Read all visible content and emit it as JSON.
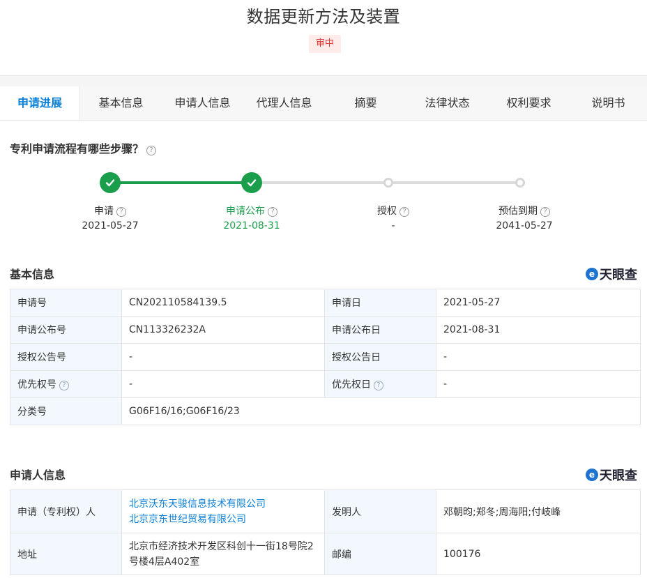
{
  "page": {
    "title": "数据更新方法及装置",
    "status_badge": "审中"
  },
  "tabs": [
    {
      "label": "申请进展",
      "active": true
    },
    {
      "label": "基本信息"
    },
    {
      "label": "申请人信息"
    },
    {
      "label": "代理人信息"
    },
    {
      "label": "摘要"
    },
    {
      "label": "法律状态"
    },
    {
      "label": "权利要求"
    },
    {
      "label": "说明书"
    }
  ],
  "process": {
    "title": "专利申请流程有哪些步骤？",
    "steps": [
      {
        "label": "申请",
        "date": "2021-05-27",
        "done": true
      },
      {
        "label": "申请公布",
        "date": "2021-08-31",
        "done": true
      },
      {
        "label": "授权",
        "date": "-",
        "done": false
      },
      {
        "label": "预估到期",
        "date": "2041-05-27",
        "done": false
      }
    ]
  },
  "brand": {
    "name": "天眼查"
  },
  "basic_info": {
    "title": "基本信息",
    "rows": [
      {
        "l1": "申请号",
        "v1": "CN202110584139.5",
        "l2": "申请日",
        "v2": "2021-05-27"
      },
      {
        "l1": "申请公布号",
        "v1": "CN113326232A",
        "l2": "申请公布日",
        "v2": "2021-08-31"
      },
      {
        "l1": "授权公告号",
        "v1": "-",
        "l2": "授权公告日",
        "v2": "-"
      },
      {
        "l1": "优先权号",
        "v1": "-",
        "l2": "优先权日",
        "v2": "-"
      },
      {
        "l1": "分类号",
        "v1": "G06F16/16;G06F16/23"
      }
    ]
  },
  "applicant_info": {
    "title": "申请人信息",
    "applicant_label": "申请（专利权）人",
    "applicants": [
      "北京沃东天骏信息技术有限公司",
      "北京京东世纪贸易有限公司"
    ],
    "inventor_label": "发明人",
    "inventors": "邓朝昀;郑冬;周海阳;付岐峰",
    "address_label": "地址",
    "address": "北京市经济技术开发区科创十一街18号院2号楼4层A402室",
    "postcode_label": "邮编",
    "postcode": "100176"
  },
  "colors": {
    "accent": "#0b7fd6",
    "done": "#1b9e4b",
    "badge_bg": "#fdecea",
    "badge_text": "#e0322d",
    "label_bg": "#f2f8fe"
  }
}
